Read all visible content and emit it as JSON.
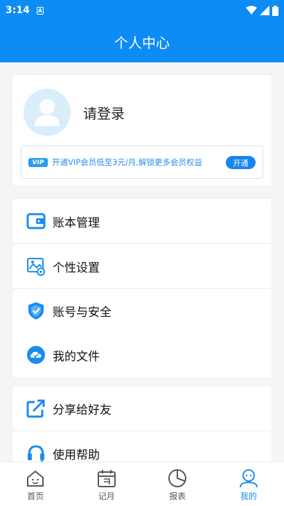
{
  "status_bar": {
    "time": "3:14",
    "notification_icon": "A"
  },
  "header": {
    "title": "个人中心"
  },
  "profile": {
    "login_text": "请登录",
    "vip": {
      "badge": "VIP",
      "text": "开通VIP会员低至3元/月,解锁更多会员权益",
      "button": "开通"
    }
  },
  "menu": {
    "items": [
      {
        "label": "账本管理",
        "icon": "wallet-icon"
      },
      {
        "label": "个性设置",
        "icon": "settings-image-icon"
      },
      {
        "label": "账号与安全",
        "icon": "shield-icon"
      },
      {
        "label": "我的文件",
        "icon": "cloud-file-icon"
      }
    ],
    "items2": [
      {
        "label": "分享给好友",
        "icon": "share-icon"
      },
      {
        "label": "使用帮助",
        "icon": "headset-icon"
      }
    ]
  },
  "tabbar": {
    "tabs": [
      {
        "label": "首页",
        "icon": "home-icon"
      },
      {
        "label": "记月",
        "icon": "calendar-icon"
      },
      {
        "label": "报表",
        "icon": "pie-chart-icon"
      },
      {
        "label": "我的",
        "icon": "profile-icon",
        "active": true
      }
    ]
  },
  "colors": {
    "primary": "#0d8cf5",
    "accent": "#1a8cf0",
    "background": "#f4f5f7"
  }
}
